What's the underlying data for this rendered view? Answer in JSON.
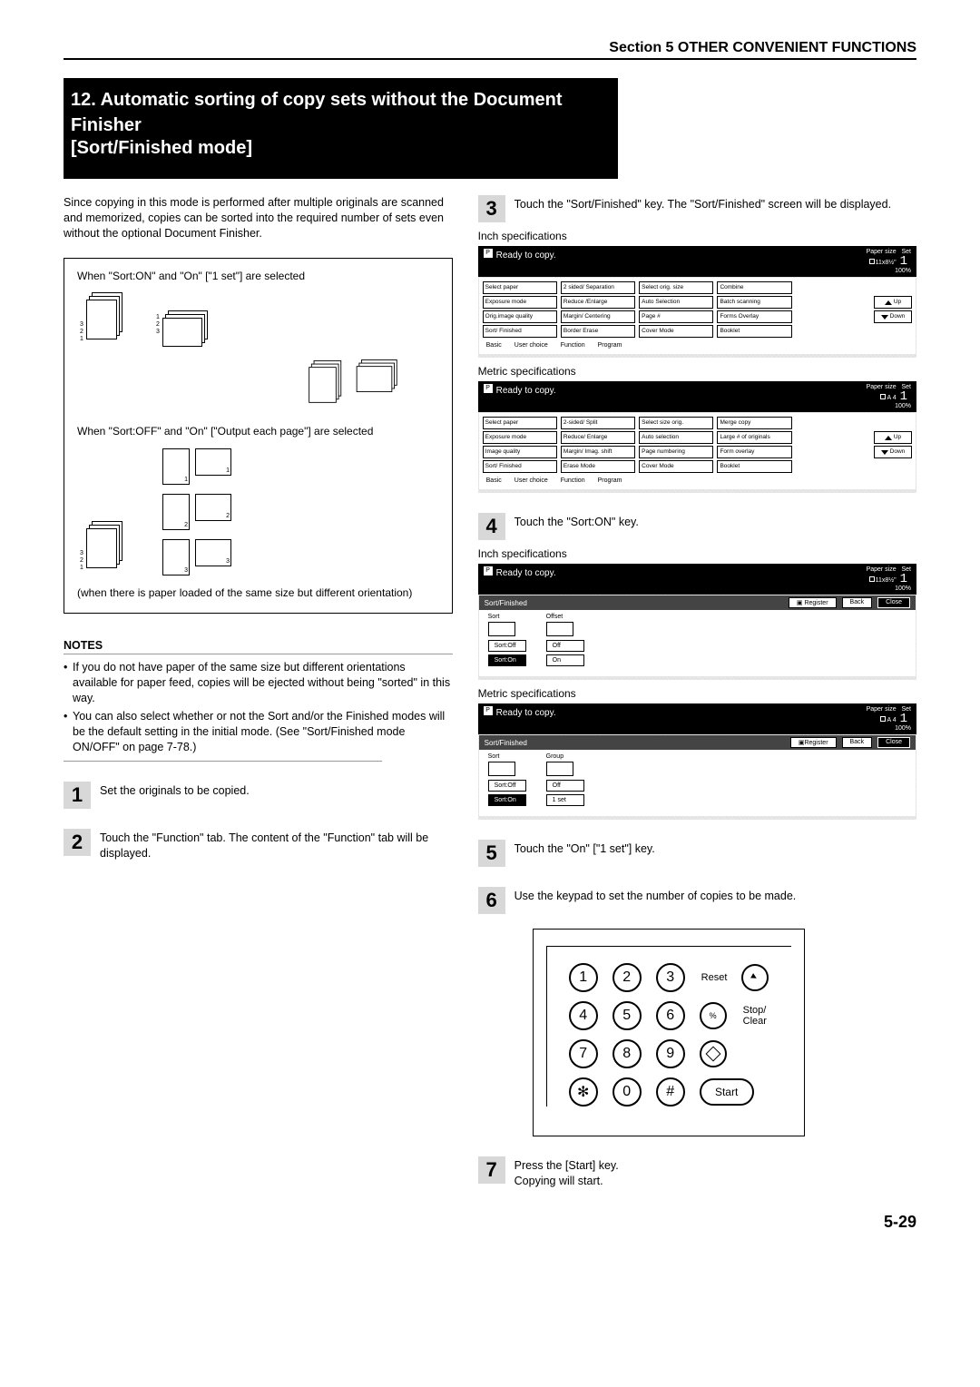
{
  "header": {
    "section": "Section 5  OTHER CONVENIENT FUNCTIONS"
  },
  "title": {
    "main": "12. Automatic sorting of copy sets without the Document Finisher",
    "sub": "[Sort/Finished mode]"
  },
  "intro": "Since copying in this mode is performed after multiple originals are scanned and memorized, copies can be sorted into the required number of sets even without the optional Document Finisher.",
  "diagram": {
    "caption1": "When \"Sort:ON\" and \"On\" [\"1 set\"] are selected",
    "caption2": "When \"Sort:OFF\" and \"On\" [\"Output each page\"] are selected",
    "footnote": "(when there is paper loaded of the same size but different orientation)"
  },
  "notes_head": "NOTES",
  "notes": [
    "If you do not have paper of the same size but different orientations available for paper feed, copies will be ejected without being \"sorted\" in this way.",
    "You can also select whether or not the Sort and/or the Finished modes will be the default setting in the initial mode. (See \"Sort/Finished mode ON/OFF\" on page 7-78.)"
  ],
  "steps": {
    "s1": "Set the originals to be copied.",
    "s2": "Touch the \"Function\" tab. The content of the \"Function\" tab will be displayed.",
    "s3": "Touch the \"Sort/Finished\" key. The \"Sort/Finished\" screen will be displayed.",
    "s4": "Touch the \"Sort:ON\" key.",
    "s5": "Touch the \"On\" [\"1 set\"] key.",
    "s6": "Use the keypad to set the number of copies to be made.",
    "s7a": "Press the [Start] key.",
    "s7b": "Copying will start."
  },
  "spec_inch": "Inch specifications",
  "spec_metric": "Metric specifications",
  "ready": "Ready to copy.",
  "panel_meta": {
    "paper": "Paper size",
    "size_in": "11x8½\"",
    "size_m": "A 4",
    "zoom": "100%",
    "set": "Set",
    "count": "1"
  },
  "fn_inch": {
    "r1": [
      "Select paper",
      "2 sided/ Separation",
      "Select orig. size",
      "Combine",
      ""
    ],
    "r2": [
      "Exposure mode",
      "Reduce /Enlarge",
      "Auto Selection",
      "Batch scanning",
      "Up"
    ],
    "r3": [
      "Orig.image quality",
      "Margin/ Centering",
      "Page #",
      "Forms Overlay",
      "Down"
    ],
    "r4": [
      "Sort/ Finished",
      "Border Erase",
      "Cover Mode",
      "Booklet",
      ""
    ],
    "tabs": [
      "Basic",
      "User choice",
      "Function",
      "Program"
    ]
  },
  "fn_metric": {
    "r1": [
      "Select paper",
      "2-sided/ Split",
      "Select size orig.",
      "Merge copy",
      ""
    ],
    "r2": [
      "Exposure mode",
      "Reduce/ Enlarge",
      "Auto selection",
      "Large # of originals",
      "Up"
    ],
    "r3": [
      "Image quality",
      "Margin/ Imag. shift",
      "Page numbering",
      "Form overlay",
      "Down"
    ],
    "r4": [
      "Sort/ Finished",
      "Erase Mode",
      "Cover Mode",
      "Booklet",
      ""
    ],
    "tabs": [
      "Basic",
      "User choice",
      "Function",
      "Program"
    ]
  },
  "sort_panel": {
    "title": "Sort/Finished",
    "register": "Register",
    "back": "Back",
    "close": "Close",
    "col1": "Sort",
    "col2_in": "Offset",
    "col2_m": "Group",
    "off": "Sort:Off",
    "on": "Sort:On",
    "opt_off_in": "Off",
    "opt_on_in": "On",
    "opt_off_m": "Off",
    "opt_on_m": "1 set"
  },
  "keypad": {
    "reset": "Reset",
    "stop": "Stop/\nClear",
    "start": "Start"
  },
  "pagenum": "5-29"
}
